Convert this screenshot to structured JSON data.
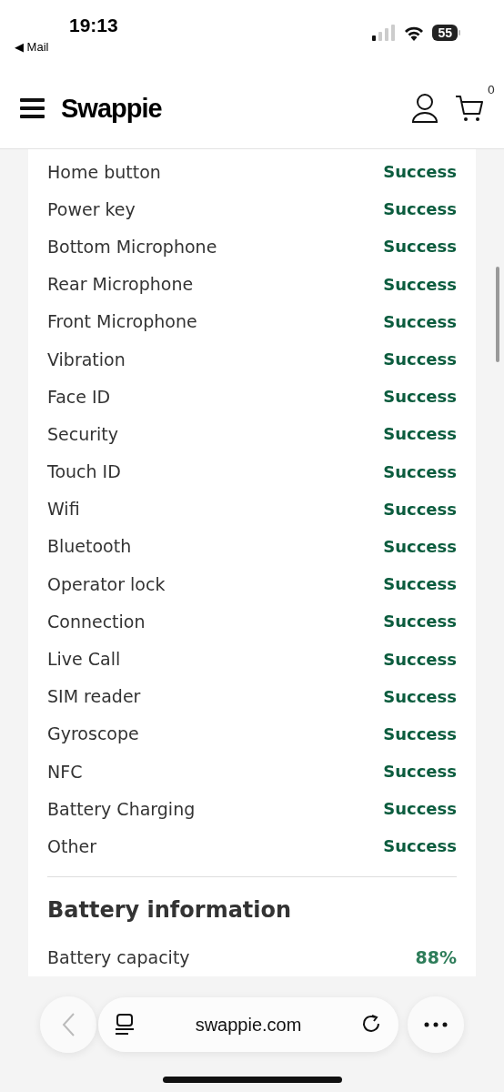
{
  "status_bar": {
    "time": "19:13",
    "back_app": "◀ Mail",
    "battery": "55"
  },
  "header": {
    "logo": "Swappie",
    "cart_count": "0"
  },
  "test_results": [
    {
      "name": "Home button",
      "result": "Success"
    },
    {
      "name": "Power key",
      "result": "Success"
    },
    {
      "name": "Bottom Microphone",
      "result": "Success"
    },
    {
      "name": "Rear Microphone",
      "result": "Success"
    },
    {
      "name": "Front Microphone",
      "result": "Success"
    },
    {
      "name": "Vibration",
      "result": "Success"
    },
    {
      "name": "Face ID",
      "result": "Success"
    },
    {
      "name": "Security",
      "result": "Success"
    },
    {
      "name": "Touch ID",
      "result": "Success"
    },
    {
      "name": "Wifi",
      "result": "Success"
    },
    {
      "name": "Bluetooth",
      "result": "Success"
    },
    {
      "name": "Operator lock",
      "result": "Success"
    },
    {
      "name": "Connection",
      "result": "Success"
    },
    {
      "name": "Live Call",
      "result": "Success"
    },
    {
      "name": "SIM reader",
      "result": "Success"
    },
    {
      "name": "Gyroscope",
      "result": "Success"
    },
    {
      "name": "NFC",
      "result": "Success"
    },
    {
      "name": "Battery Charging",
      "result": "Success"
    },
    {
      "name": "Other",
      "result": "Success"
    }
  ],
  "battery_information": {
    "title": "Battery information",
    "rows": [
      {
        "name": "Battery capacity",
        "value": "88%"
      }
    ]
  },
  "browser_toolbar": {
    "url": "swappie.com",
    "back_disabled": true
  }
}
